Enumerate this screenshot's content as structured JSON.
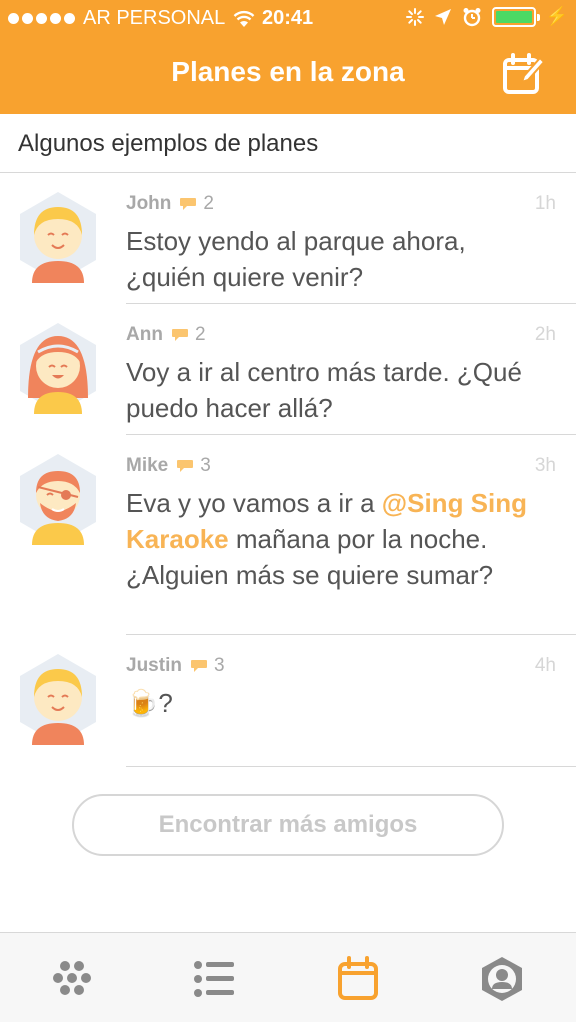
{
  "status_bar": {
    "carrier": "AR PERSONAL",
    "time": "20:41",
    "battery_color": "#4cd964"
  },
  "nav": {
    "title": "Planes en la zona",
    "compose_icon": "calendar-compose-icon",
    "bar_color": "#f8a22f"
  },
  "section": {
    "header": "Algunos ejemplos de planes"
  },
  "posts": [
    {
      "name": "John",
      "comments": "2",
      "time": "1h",
      "text": "Estoy yendo al parque ahora, ¿quién quiere venir?",
      "avatar": "blonde-avatar"
    },
    {
      "name": "Ann",
      "comments": "2",
      "time": "2h",
      "text": "Voy a ir al centro más tarde. ¿Qué puedo hacer allá?",
      "avatar": "redhead-girl-avatar"
    },
    {
      "name": "Mike",
      "comments": "3",
      "time": "3h",
      "text_before": "Eva y yo vamos a ir a ",
      "mention": "@Sing Sing Karaoke",
      "text_after": " mañana por la noche. ¿Alguien más se quiere sumar?",
      "avatar": "pirate-avatar"
    },
    {
      "name": "Justin",
      "comments": "3",
      "time": "4h",
      "text_emoji": "🍺",
      "text": "?",
      "avatar": "blonde-avatar"
    }
  ],
  "find_friends_button": "Encontrar más amigos",
  "tabs": [
    {
      "icon": "grid-dots-icon",
      "active": false
    },
    {
      "icon": "list-icon",
      "active": false
    },
    {
      "icon": "calendar-icon",
      "active": true
    },
    {
      "icon": "profile-icon",
      "active": false
    }
  ],
  "colors": {
    "accent": "#f8a22f",
    "mention": "#f8b455",
    "inactive_tab": "#8a8a8a"
  }
}
